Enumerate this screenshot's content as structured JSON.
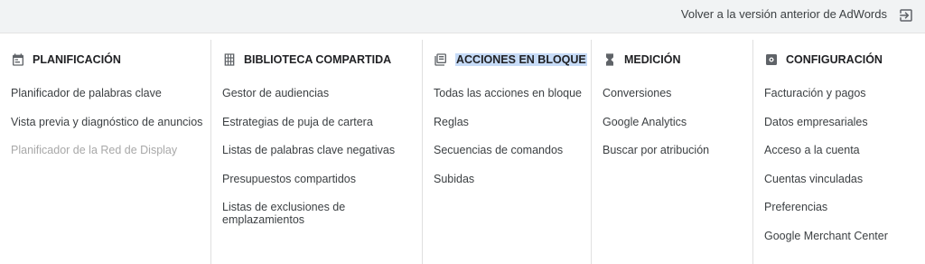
{
  "topbar": {
    "back_label": "Volver a la versión anterior de AdWords",
    "back_icon": "exit-to-app-icon"
  },
  "colors": {
    "topbar_bg": "#f1f3f4",
    "highlight": "#c6dbf7",
    "disabled_text": "#a8a8a8"
  },
  "columns": [
    {
      "title": "PLANIFICACIÓN",
      "icon": "calendar-icon",
      "items": [
        "Planificador de palabras clave",
        "Vista previa y diagnóstico de anuncios",
        "Planificador de la Red de Display"
      ],
      "disabled_item": "Planificador de la Red de Display"
    },
    {
      "title": "BIBLIOTECA COMPARTIDA",
      "icon": "grid-icon",
      "items": [
        "Gestor de audiencias",
        "Estrategias de puja de cartera",
        "Listas de palabras clave negativas",
        "Presupuestos compartidos",
        "Listas de exclusiones de emplazamientos"
      ]
    },
    {
      "title": "ACCIONES EN BLOQUE",
      "icon": "copy-icon",
      "highlighted": true,
      "items": [
        "Todas las acciones en bloque",
        "Reglas",
        "Secuencias de comandos",
        "Subidas"
      ]
    },
    {
      "title": "MEDICIÓN",
      "icon": "hourglass-icon",
      "items": [
        "Conversiones",
        "Google Analytics",
        "Buscar por atribución"
      ]
    },
    {
      "title": "CONFIGURACIÓN",
      "icon": "settings-icon",
      "items": [
        "Facturación y pagos",
        "Datos empresariales",
        "Acceso a la cuenta",
        "Cuentas vinculadas",
        "Preferencias",
        "Google Merchant Center"
      ]
    }
  ]
}
